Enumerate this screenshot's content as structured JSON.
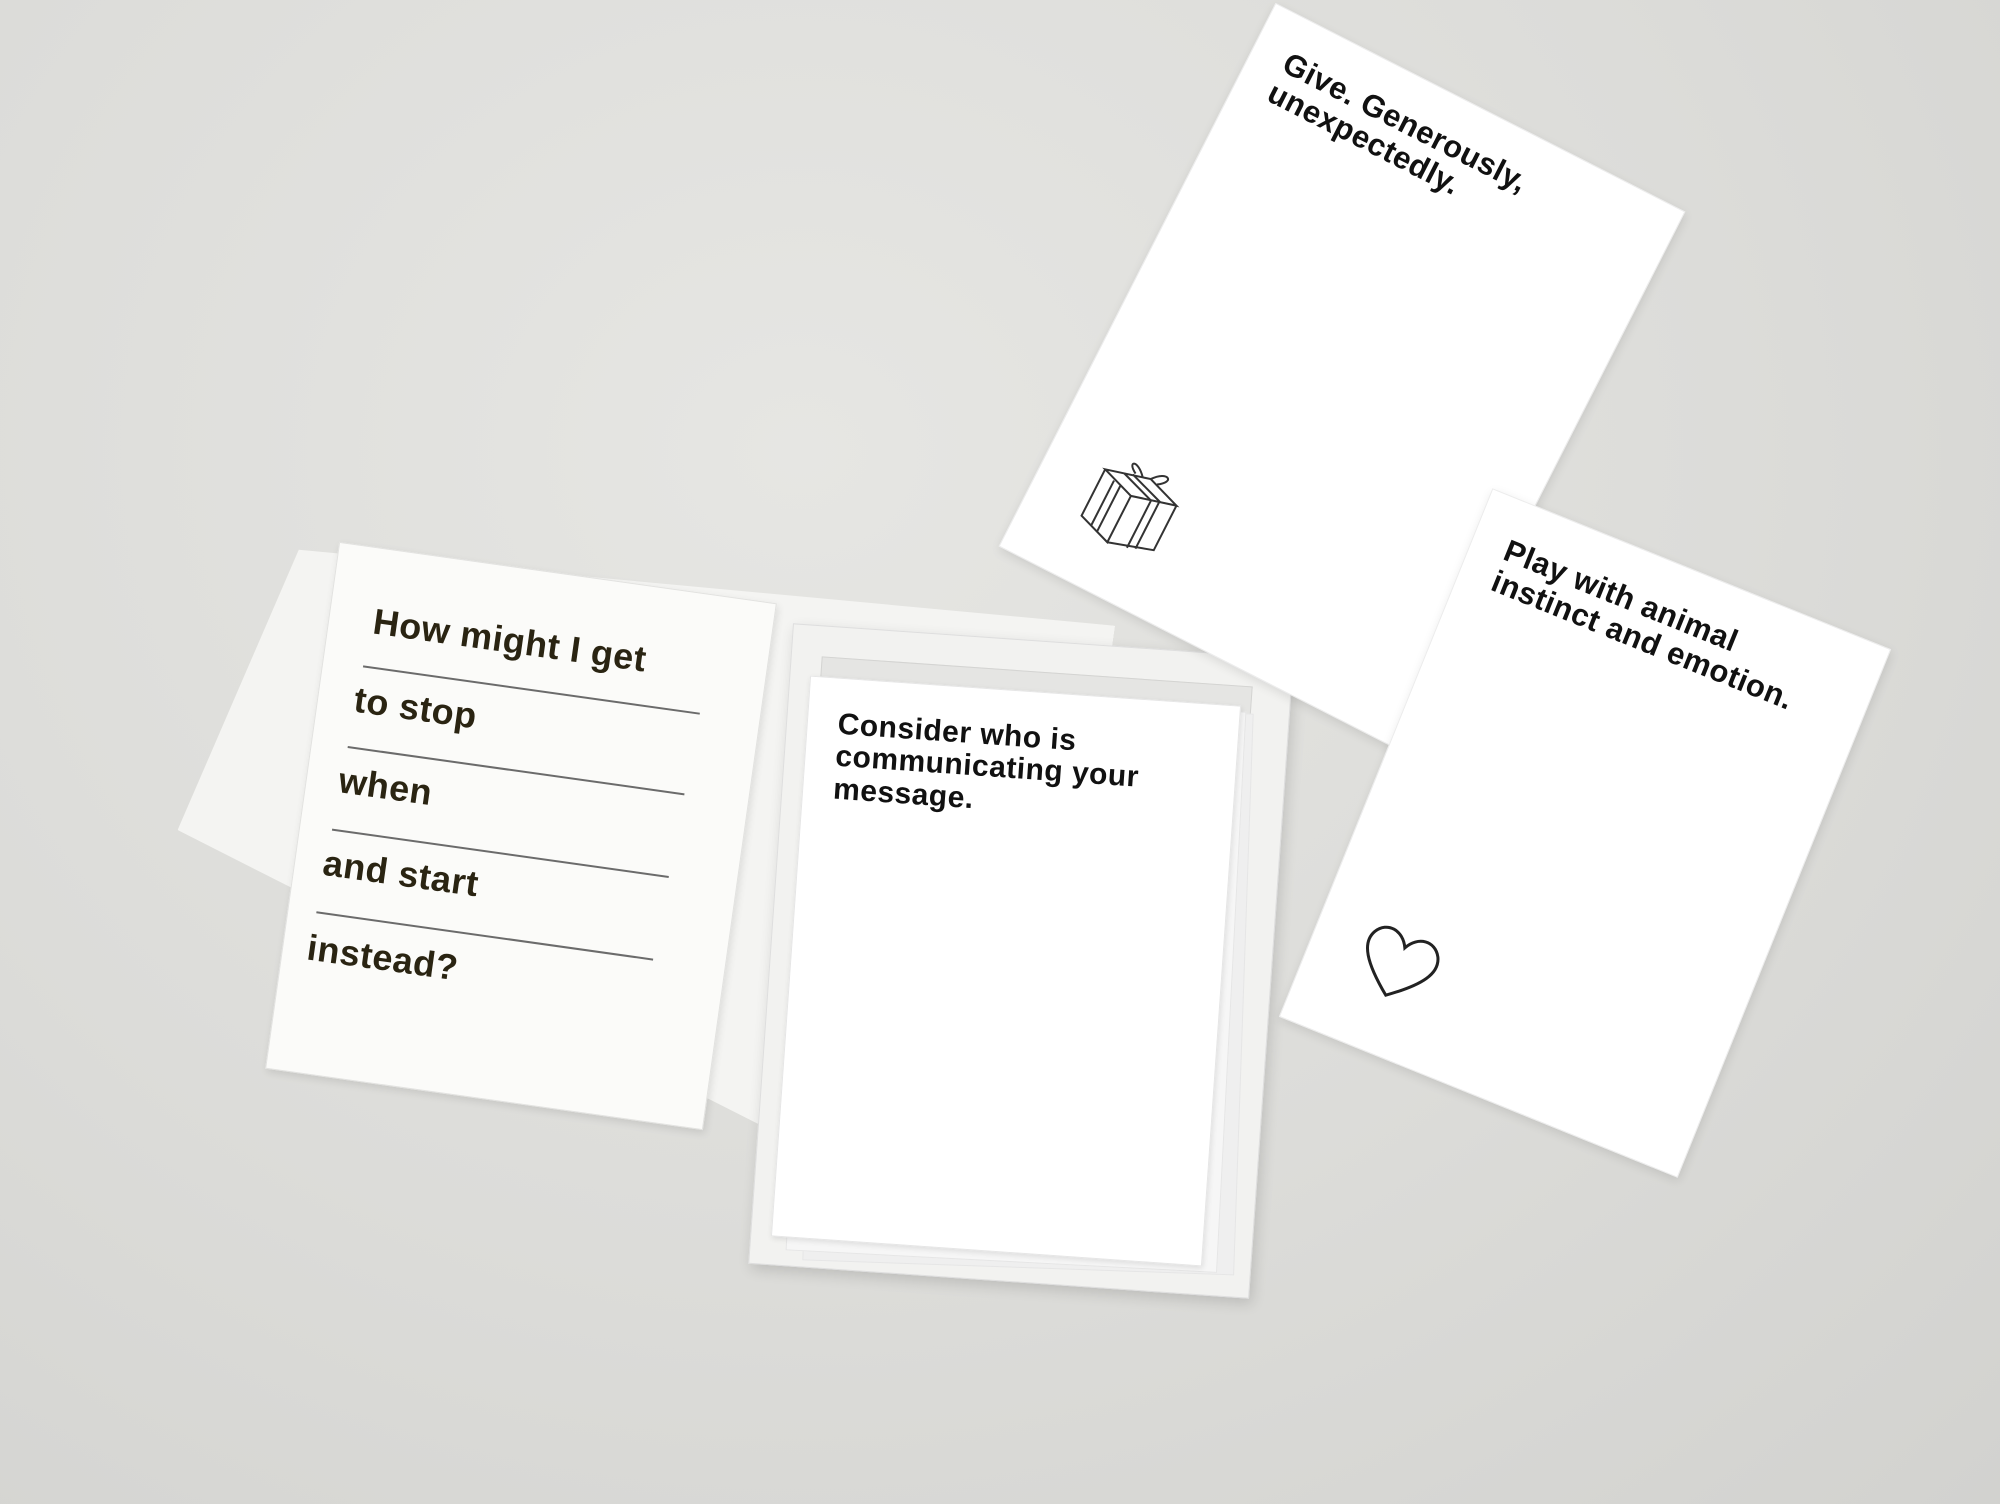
{
  "cards": {
    "gift": {
      "text": "Give. Generously, unexpectedly.",
      "icon": "gift-box-icon"
    },
    "play": {
      "text": "Play with animal instinct and emotion.",
      "icon": "heart-icon"
    },
    "deck_top": {
      "text": "Consider who is communicating your message."
    }
  },
  "prompt_sheet": {
    "lines": [
      "How might I get",
      "to stop",
      "when",
      "and start",
      "instead?"
    ]
  }
}
